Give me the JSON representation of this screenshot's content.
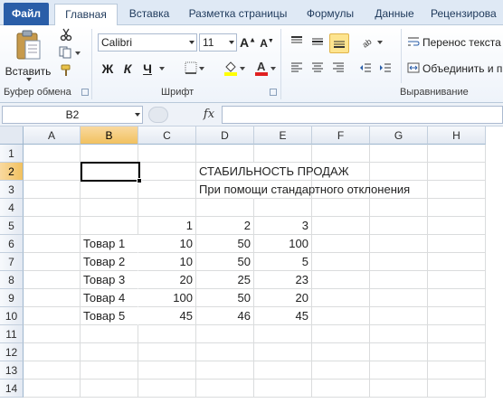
{
  "ribbon_tabs": [
    "Файл",
    "Главная",
    "Вставка",
    "Разметка страницы",
    "Формулы",
    "Данные",
    "Рецензирова"
  ],
  "ribbon": {
    "clipboard": {
      "paste_label": "Вставить",
      "group_label": "Буфер обмена"
    },
    "font": {
      "font_name": "Calibri",
      "font_size": "11",
      "bold": "Ж",
      "italic": "К",
      "underline": "Ч",
      "group_label": "Шрифт"
    },
    "alignment": {
      "wrap_text": "Перенос текста",
      "merge": "Объединить и п",
      "group_label": "Выравнивание"
    }
  },
  "formula_bar": {
    "name_box": "B2",
    "fx_label": "fx",
    "formula": ""
  },
  "grid": {
    "columns": [
      "A",
      "B",
      "C",
      "D",
      "E",
      "F",
      "G",
      "H"
    ],
    "rows": [
      "1",
      "2",
      "3",
      "4",
      "5",
      "6",
      "7",
      "8",
      "9",
      "10",
      "11",
      "12",
      "13",
      "14"
    ],
    "selected_column": "B",
    "selected_row": "2",
    "cells": {
      "D2": "СТАБИЛЬНОСТЬ ПРОДАЖ",
      "D3": "При помощи стандартного отклонения",
      "C5": "1",
      "D5": "2",
      "E5": "3",
      "B6": "Товар 1",
      "C6": "10",
      "D6": "50",
      "E6": "100",
      "B7": "Товар 2",
      "C7": "10",
      "D7": "50",
      "E7": "5",
      "B8": "Товар 3",
      "C8": "20",
      "D8": "25",
      "E8": "23",
      "B9": "Товар 4",
      "C9": "100",
      "D9": "50",
      "E9": "20",
      "B10": "Товар 5",
      "C10": "45",
      "D10": "46",
      "E10": "45"
    }
  },
  "colors": {
    "file_tab": "#2a5ea8",
    "selection_header": "#f1c15f",
    "grid_line": "#dadcdd"
  }
}
